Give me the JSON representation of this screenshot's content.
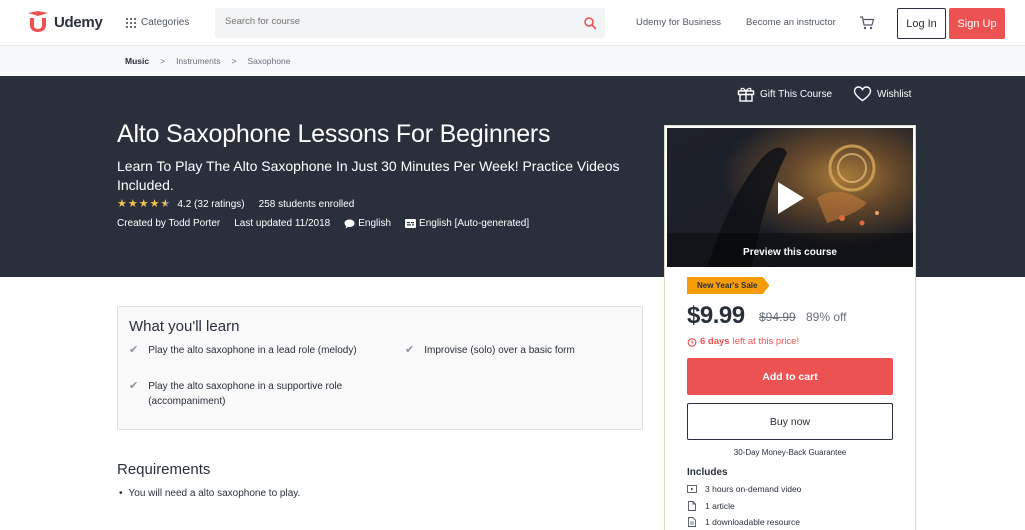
{
  "header": {
    "logo_text": "Udemy",
    "categories_label": "Categories",
    "search_placeholder": "Search for course",
    "business_link": "Udemy for Business",
    "instructor_link": "Become an instructor",
    "login_label": "Log In",
    "signup_label": "Sign Up"
  },
  "breadcrumb": [
    "Music",
    "Instruments",
    "Saxophone"
  ],
  "hero": {
    "gift_label": "Gift This Course",
    "wishlist_label": "Wishlist",
    "title": "Alto Saxophone Lessons For Beginners",
    "subtitle": "Learn To Play The Alto Saxophone In Just 30 Minutes Per Week! Practice Videos Included.",
    "rating": 4.2,
    "rating_text": "4.2 (32 ratings)",
    "enrolled": "258 students enrolled",
    "created_by": "Created by Todd Porter",
    "last_updated": "Last updated 11/2018",
    "language": "English",
    "captions": "English [Auto-generated]"
  },
  "card": {
    "preview_label": "Preview this course",
    "sale_badge": "New Year's Sale",
    "price": "$9.99",
    "original_price": "$94.99",
    "discount": "89% off",
    "timer_days": "6 days",
    "timer_rest": "left at this price!",
    "add_to_cart": "Add to cart",
    "buy_now": "Buy now",
    "guarantee": "30-Day Money-Back Guarantee",
    "includes_title": "Includes",
    "includes": [
      {
        "icon": "video-icon",
        "text": "3 hours on-demand video"
      },
      {
        "icon": "article-icon",
        "text": "1 article"
      },
      {
        "icon": "resource-icon",
        "text": "1 downloadable resource"
      }
    ]
  },
  "learn": {
    "title": "What you'll learn",
    "items": [
      "Play the alto saxophone in a lead role (melody)",
      "Play the alto saxophone in a supportive role (accompaniment)",
      "Improvise (solo) over a basic form"
    ]
  },
  "requirements": {
    "title": "Requirements",
    "items": [
      "You will need a alto saxophone to play."
    ]
  },
  "colors": {
    "brand_red": "#ec5252",
    "hero_bg": "#29303b",
    "star": "#f4c150",
    "sale_badge": "#f69c08"
  }
}
